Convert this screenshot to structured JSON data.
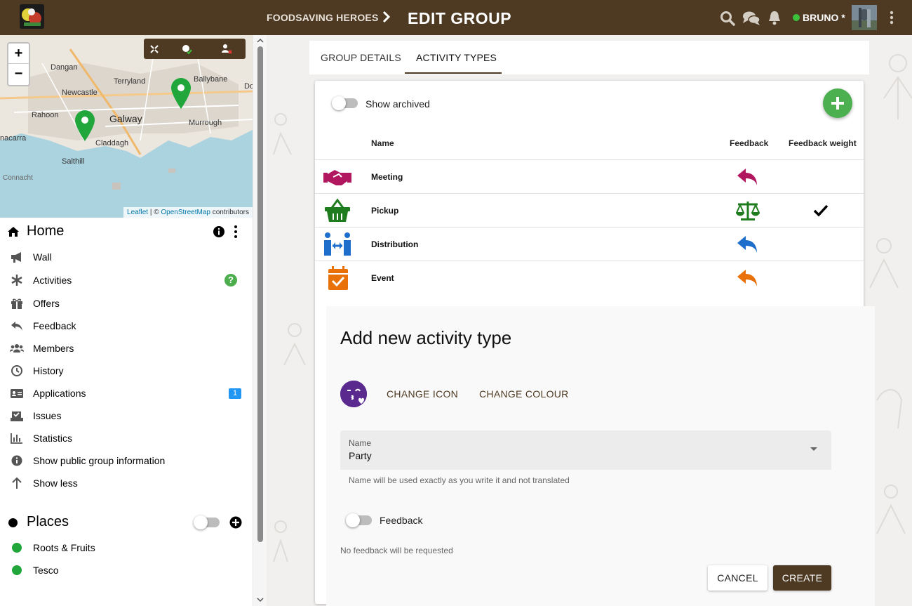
{
  "topbar": {
    "breadcrumb": "FOODSAVING HEROES",
    "title": "EDIT GROUP",
    "user_name": "BRUNO *",
    "status_color": "#3cc13c",
    "bar_color": "#4e3a23"
  },
  "map": {
    "zoom_in": "+",
    "zoom_out": "−",
    "places": [
      "Dangan",
      "Terryland",
      "Ballybane",
      "Newcastle",
      "Galway",
      "Rahoon",
      "Claddagh",
      "Murrough",
      "Salthill",
      "nacarra",
      "Connacht",
      "Do"
    ],
    "attribution": {
      "leaflet": "Leaflet",
      "sep": " | © ",
      "osm": "OpenStreetMap",
      "contributors": " contributors"
    }
  },
  "sidebar": {
    "home_title": "Home",
    "items": [
      {
        "label": "Wall",
        "icon": "megaphone-icon"
      },
      {
        "label": "Activities",
        "icon": "asterisk-icon",
        "help": "?"
      },
      {
        "label": "Offers",
        "icon": "gift-icon"
      },
      {
        "label": "Feedback",
        "icon": "reply-icon"
      },
      {
        "label": "Members",
        "icon": "users-icon"
      },
      {
        "label": "History",
        "icon": "clock-icon"
      },
      {
        "label": "Applications",
        "icon": "id-card-icon",
        "badge": "1"
      },
      {
        "label": "Issues",
        "icon": "vote-icon"
      },
      {
        "label": "Statistics",
        "icon": "bar-chart-icon"
      },
      {
        "label": "Show public group information",
        "icon": "info-icon"
      },
      {
        "label": "Show less",
        "icon": "arrow-up-icon"
      }
    ],
    "places_title": "Places",
    "places": [
      {
        "label": "Roots & Fruits",
        "color": "#21a63b"
      },
      {
        "label": "Tesco",
        "color": "#21a63b"
      }
    ]
  },
  "tabs": [
    "GROUP DETAILS",
    "ACTIVITY TYPES"
  ],
  "activity_types": {
    "show_archived_label": "Show archived",
    "headers": {
      "name": "Name",
      "feedback": "Feedback",
      "weight": "Feedback weight"
    },
    "rows": [
      {
        "name": "Meeting",
        "color": "#b0175f",
        "icon": "handshake-icon",
        "feedback_weight": false
      },
      {
        "name": "Pickup",
        "color": "#1e7b1e",
        "icon": "basket-icon",
        "feedback_weight": true
      },
      {
        "name": "Distribution",
        "color": "#1e6fcc",
        "icon": "people-arrows-icon",
        "feedback_weight": false
      },
      {
        "name": "Event",
        "color": "#e8710a",
        "icon": "calendar-check-icon",
        "feedback_weight": false
      }
    ]
  },
  "dialog": {
    "title": "Add new activity type",
    "icon_color": "#5b2a8e",
    "change_icon": "CHANGE ICON",
    "change_colour": "CHANGE COLOUR",
    "name_label": "Name",
    "name_value": "Party",
    "name_hint": "Name will be used exactly as you write it and not translated",
    "feedback_label": "Feedback",
    "feedback_hint": "No feedback will be requested",
    "cancel": "CANCEL",
    "create": "CREATE"
  }
}
